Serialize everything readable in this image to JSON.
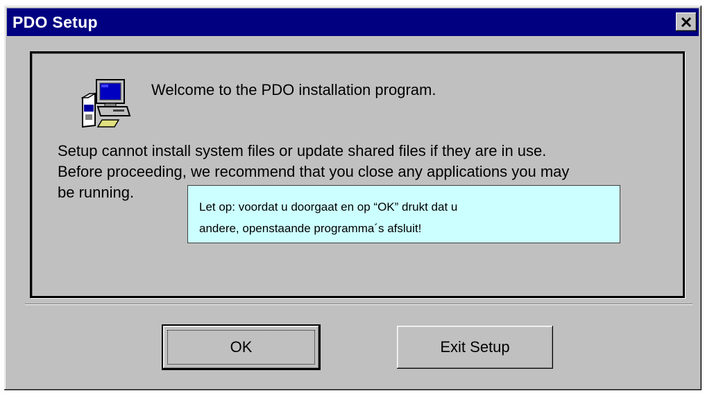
{
  "window": {
    "title": "PDO Setup",
    "close_icon": "close-icon"
  },
  "content": {
    "icon": "computer-setup-icon",
    "welcome": "Welcome to the PDO installation program.",
    "body_lines": [
      "Setup cannot install system files or update shared files if they are in use.",
      "Before proceeding, we recommend that you close any applications you may",
      "be running."
    ],
    "note_lines": [
      "Let op: voordat u doorgaat en op “OK” drukt dat u",
      "andere, openstaande programma´s afsluit!"
    ],
    "note_color": "#ccffff"
  },
  "buttons": {
    "ok_label": "OK",
    "exit_label": "Exit Setup"
  },
  "colors": {
    "titlebar": "#000080",
    "window_face": "#c0c0c0"
  }
}
